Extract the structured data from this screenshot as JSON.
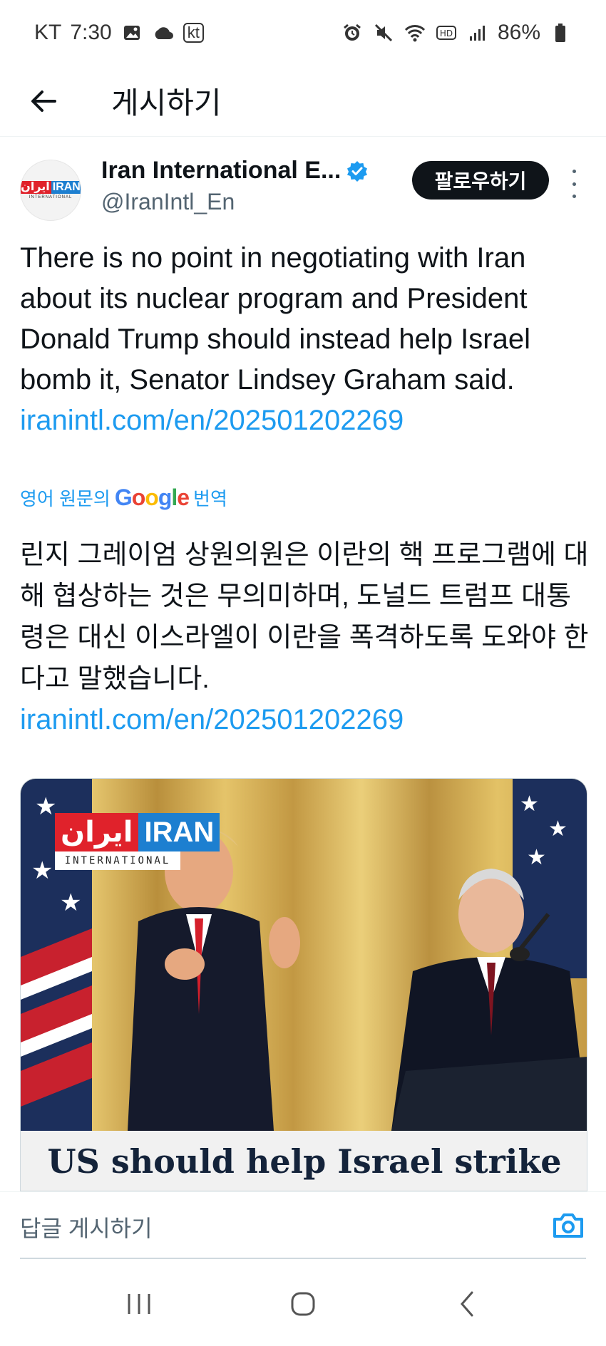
{
  "status_bar": {
    "carrier": "KT",
    "time": "7:30",
    "kt_badge": "kt",
    "battery": "86%"
  },
  "app_bar": {
    "title": "게시하기"
  },
  "tweet": {
    "author_name": "Iran International E...",
    "handle": "@IranIntl_En",
    "follow_label": "팔로우하기",
    "avatar_logo_red": "ايران",
    "avatar_logo_blue": "IRAN",
    "avatar_logo_sub": "INTERNATIONAL",
    "text": "There is no point in negotiating with Iran about its nuclear program and President Donald Trump should instead help Israel bomb it, Senator Lindsey Graham said.",
    "link": "iranintl.com/en/202501202269",
    "translate_prefix": "영어 원문의",
    "translate_suffix": "번역",
    "translated_text": "린지 그레이엄 상원의원은 이란의 핵 프로그램에 대해 협상하는 것은 무의미하며, 도널드 트럼프 대통령은 대신 이스라엘이 이란을 폭격하도록 도와야 한다고 말했습니다.",
    "translated_link": "iranintl.com/en/202501202269",
    "media": {
      "logo_red": "ايران",
      "logo_blue": "IRAN",
      "logo_caption": "INTERNATIONAL",
      "headline": "US should help Israel strike"
    }
  },
  "reply": {
    "placeholder": "답글 게시하기"
  },
  "colors": {
    "accent": "#1d9bf0",
    "text": "#0f1419",
    "secondary": "#536471",
    "follow_bg": "#0f1419"
  }
}
